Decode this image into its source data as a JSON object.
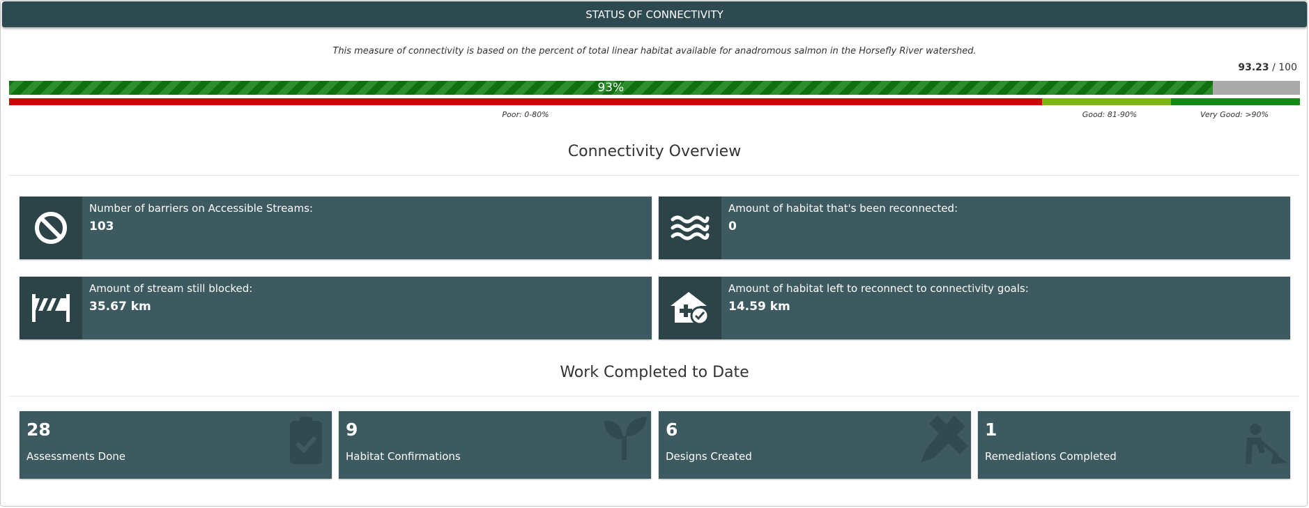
{
  "header": {
    "title": "STATUS OF CONNECTIVITY"
  },
  "description": "This measure of connectivity is based on the percent of total linear habitat available for anadromous salmon in the Horsefly River watershed.",
  "score": {
    "value": "93.23",
    "max": "/ 100"
  },
  "progress": {
    "fraction": 0.9323,
    "label": "93%"
  },
  "scale": {
    "poor_label": "Poor: 0-80%",
    "good_label": "Good: 81-90%",
    "very_good_label": "Very Good: >90%"
  },
  "overview": {
    "title": "Connectivity Overview",
    "cards": [
      {
        "label": "Number of barriers on Accessible Streams:",
        "value": "103",
        "icon": "ban-icon"
      },
      {
        "label": "Amount of habitat that's been reconnected:",
        "value": "0",
        "icon": "water-icon"
      },
      {
        "label": "Amount of stream still blocked:",
        "value": "35.67 km",
        "icon": "road-barrier-icon"
      },
      {
        "label": "Amount of habitat left to reconnect to connectivity goals:",
        "value": "14.59 km",
        "icon": "house-medical-check-icon"
      }
    ]
  },
  "work": {
    "title": "Work Completed to Date",
    "cards": [
      {
        "value": "28",
        "label": "Assessments Done",
        "icon": "clipboard-check-icon"
      },
      {
        "value": "9",
        "label": "Habitat Confirmations",
        "icon": "seedling-icon"
      },
      {
        "value": "6",
        "label": "Designs Created",
        "icon": "pencil-ruler-icon"
      },
      {
        "value": "1",
        "label": "Remediations Completed",
        "icon": "person-digging-icon"
      }
    ]
  },
  "colors": {
    "header": "#2c4a50",
    "card": "#3d5a60",
    "card_icon_bg": "#2c4348",
    "progress_green": "#1b7d1b",
    "poor": "#d20000",
    "good": "#7cb518",
    "very_good": "#138a13"
  }
}
